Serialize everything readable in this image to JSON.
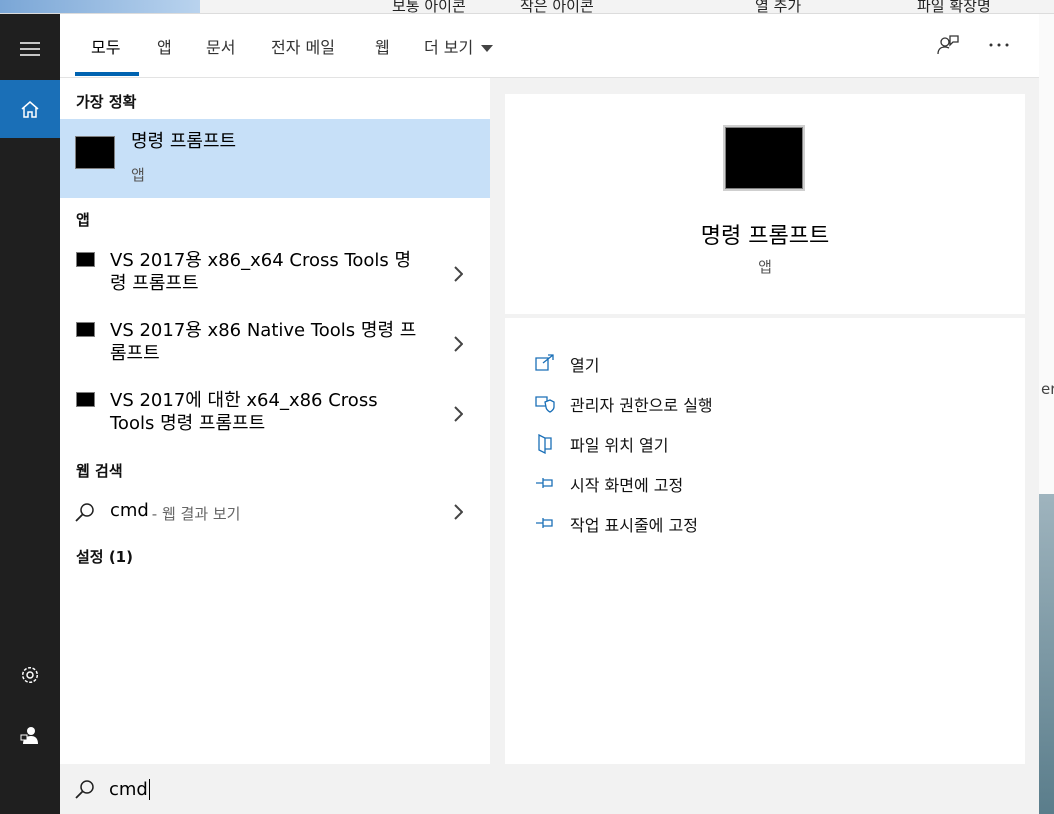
{
  "background": {
    "explorer_items": [
      "보통 아이콘",
      "작은 아이콘",
      "열 추가",
      "파일 확장명"
    ],
    "right_edge_text": "er"
  },
  "tabs": [
    "모두",
    "앱",
    "문서",
    "전자 메일",
    "웹",
    "더 보기"
  ],
  "sections": {
    "best_match": "가장 정확",
    "apps": "앱",
    "web_search": "웹 검색",
    "settings": "설정 (1)"
  },
  "best_match": {
    "title": "명령 프롬프트",
    "subtitle": "앱"
  },
  "apps": [
    {
      "line1": "VS 2017용 x86_x64 Cross Tools 명",
      "line2": "령 프롬프트"
    },
    {
      "line1": "VS 2017용 x86 Native Tools 명령 프",
      "line2": "롬프트"
    },
    {
      "line1": "VS 2017에 대한 x64_x86 Cross",
      "line2": "Tools 명령 프롬프트"
    }
  ],
  "web": {
    "query": "cmd",
    "suffix": " - 웹 결과 보기"
  },
  "preview": {
    "title": "명령 프롬프트",
    "subtitle": "앱"
  },
  "actions": [
    "열기",
    "관리자 권한으로 실행",
    "파일 위치 열기",
    "시작 화면에 고정",
    "작업 표시줄에 고정"
  ],
  "search": {
    "value": "cmd"
  },
  "colors": {
    "accent": "#0063b1",
    "rail": "#1f1f1f",
    "home": "#1a6fb7",
    "selected": "#c7e0f8"
  },
  "icons": {
    "rail": [
      "hamburger-icon",
      "home-icon",
      "settings-gear-icon",
      "user-icon"
    ],
    "topbar": [
      "feedback-icon",
      "more-options-icon"
    ],
    "actions": [
      "open-icon",
      "shield-icon",
      "folder-location-icon",
      "pin-icon",
      "pin-icon"
    ]
  }
}
